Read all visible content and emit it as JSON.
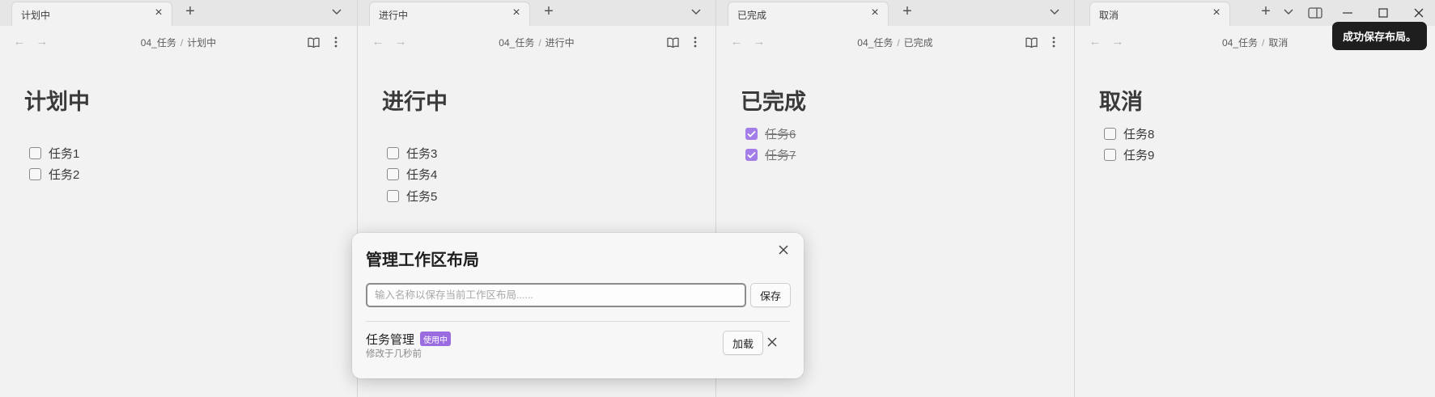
{
  "panes": [
    {
      "tab_title": "计划中",
      "breadcrumb": {
        "folder": "04_任务",
        "separator": "/",
        "file": "计划中"
      },
      "heading": "计划中",
      "tasks": [
        {
          "label": "任务1",
          "checked": false
        },
        {
          "label": "任务2",
          "checked": false
        }
      ]
    },
    {
      "tab_title": "进行中",
      "breadcrumb": {
        "folder": "04_任务",
        "separator": "/",
        "file": "进行中"
      },
      "heading": "进行中",
      "tasks": [
        {
          "label": "任务3",
          "checked": false
        },
        {
          "label": "任务4",
          "checked": false
        },
        {
          "label": "任务5",
          "checked": false
        }
      ]
    },
    {
      "tab_title": "已完成",
      "breadcrumb": {
        "folder": "04_任务",
        "separator": "/",
        "file": "已完成"
      },
      "heading": "已完成",
      "tasks": [
        {
          "label": "任务6",
          "checked": true
        },
        {
          "label": "任务7",
          "checked": true
        }
      ]
    },
    {
      "tab_title": "取消",
      "breadcrumb": {
        "folder": "04_任务",
        "separator": "/",
        "file": "取消"
      },
      "heading": "取消",
      "tasks": [
        {
          "label": "任务8",
          "checked": false
        },
        {
          "label": "任务9",
          "checked": false
        }
      ]
    }
  ],
  "toast": {
    "message": "成功保存布局。"
  },
  "modal": {
    "title": "管理工作区布局",
    "input_placeholder": "输入名称以保存当前工作区布局......",
    "input_value": "",
    "save_label": "保存",
    "layouts": [
      {
        "name": "任务管理",
        "badge": "使用中",
        "subtitle": "修改于几秒前",
        "load_label": "加载"
      }
    ]
  },
  "icons": {
    "tab_close": "close-icon",
    "new_tab": "plus-icon",
    "tab_list": "chevron-down-icon",
    "back": "arrow-left-icon",
    "forward": "arrow-right-icon",
    "reading_view": "book-open-icon",
    "more_options": "more-vertical-icon",
    "sidebar_toggle": "sidebar-right-icon",
    "minimize": "minimize-icon",
    "maximize": "maximize-icon",
    "window_close": "close-icon"
  },
  "colors": {
    "accent": "#a37ee8",
    "badge": "#9a6ce0",
    "background": "#f2f2f2",
    "toast_bg": "#1e1e1e"
  }
}
